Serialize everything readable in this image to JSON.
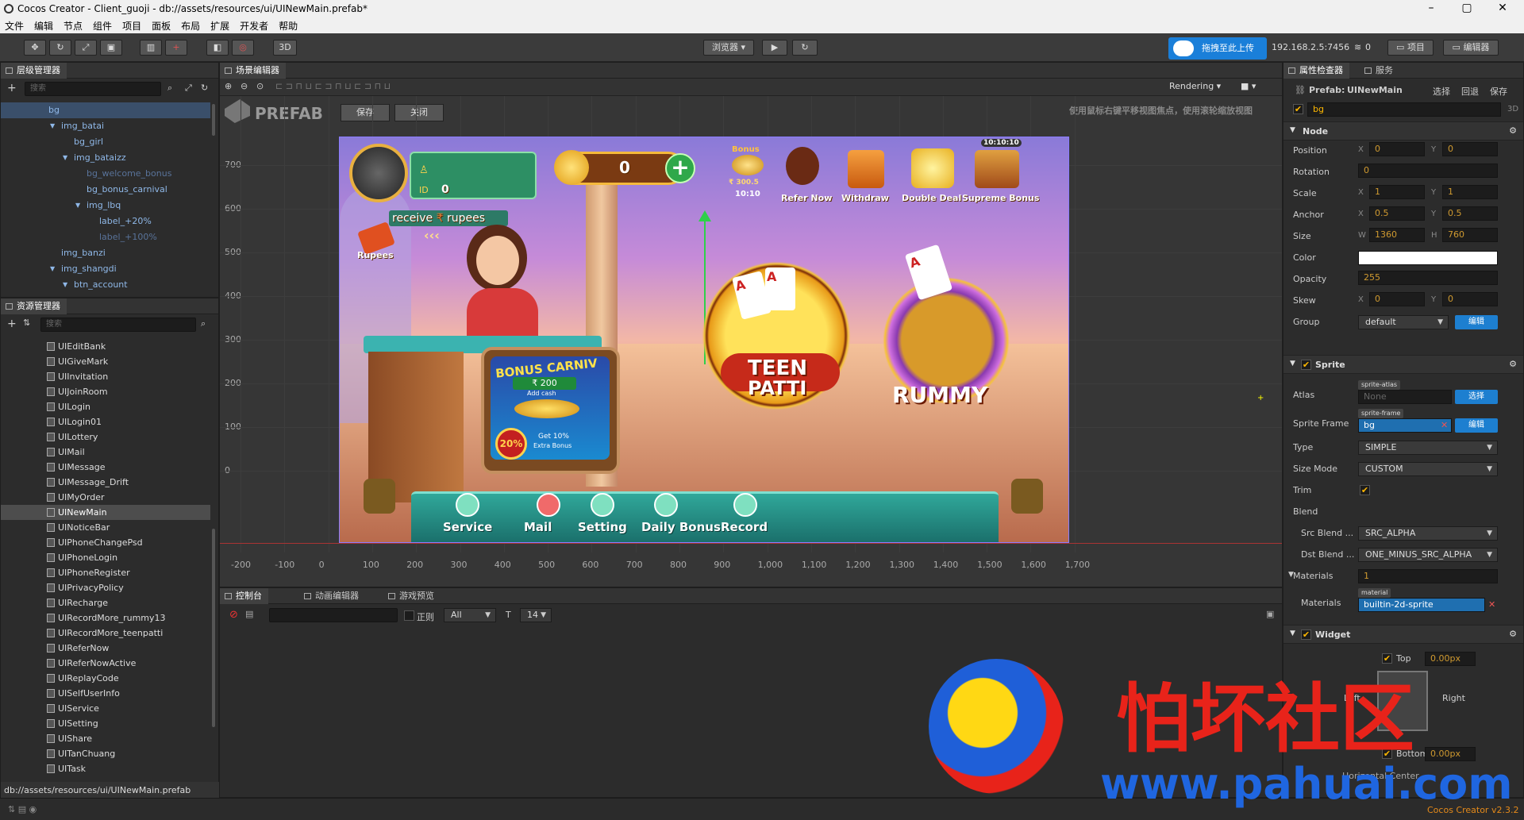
{
  "window": {
    "title": "Cocos Creator - Client_guoji - db://assets/resources/ui/UINewMain.prefab*"
  },
  "menu": [
    "文件",
    "编辑",
    "节点",
    "组件",
    "项目",
    "面板",
    "布局",
    "扩展",
    "开发者",
    "帮助"
  ],
  "toolbar": {
    "btn_3d": "3D",
    "browser": "浏览器 ▾",
    "upload": "拖拽至此上传",
    "ip": "192.168.2.5:7456",
    "count": "0",
    "project": "项目",
    "editor": "编辑器"
  },
  "hierarchy": {
    "tab": "层级管理器",
    "search_placeholder": "搜索",
    "items": [
      {
        "label": "bg",
        "indent": 0
      },
      {
        "label": "img_batai",
        "indent": 1
      },
      {
        "label": "bg_girl",
        "indent": 2
      },
      {
        "label": "img_bataizz",
        "indent": 2
      },
      {
        "label": "bg_welcome_bonus",
        "indent": 3,
        "dim": true
      },
      {
        "label": "bg_bonus_carnival",
        "indent": 3
      },
      {
        "label": "img_lbq",
        "indent": 3
      },
      {
        "label": "label_+20%",
        "indent": 4
      },
      {
        "label": "label_+100%",
        "indent": 4,
        "dim": true
      },
      {
        "label": "img_banzi",
        "indent": 1
      },
      {
        "label": "img_shangdi",
        "indent": 1
      },
      {
        "label": "btn_account",
        "indent": 2
      }
    ]
  },
  "assets": {
    "tab": "资源管理器",
    "search_placeholder": "搜索",
    "items": [
      "UIEditBank",
      "UIGiveMark",
      "UIInvitation",
      "UIJoinRoom",
      "UILogin",
      "UILogin01",
      "UILottery",
      "UIMail",
      "UIMessage",
      "UIMessage_Drift",
      "UIMyOrder",
      "UINewMain",
      "UINoticeBar",
      "UIPhoneChangePsd",
      "UIPhoneLogin",
      "UIPhoneRegister",
      "UIPrivacyPolicy",
      "UIRecharge",
      "UIRecordMore_rummy13",
      "UIRecordMore_teenpatti",
      "UIReferNow",
      "UIReferNowActive",
      "UIReplayCode",
      "UISelfUserInfo",
      "UIService",
      "UISetting",
      "UIShare",
      "UITanChuang",
      "UITask"
    ],
    "selected": "UINewMain",
    "path": "db://assets/resources/ui/UINewMain.prefab"
  },
  "scene": {
    "tab": "场景编辑器",
    "rendering": "Rendering",
    "prefab_label": "PREFAB",
    "save": "保存",
    "close": "关闭",
    "hint": "使用鼠标右键平移视图焦点，使用滚轮缩放视图",
    "y_ticks": [
      "700",
      "600",
      "500",
      "400",
      "300",
      "200",
      "100",
      "0"
    ],
    "x_ticks": [
      "-200",
      "-100",
      "0",
      "100",
      "200",
      "300",
      "400",
      "500",
      "600",
      "700",
      "800",
      "900",
      "1,000",
      "1,100",
      "1,200",
      "1,300",
      "1,400",
      "1,500",
      "1,600",
      "1,700"
    ]
  },
  "game": {
    "coins": "0",
    "id_value": "0",
    "receive": "receive",
    "rupees_word": "rupees",
    "rupees_icon": "Rupees",
    "bonus": "Bonus",
    "bonus_amount": "₹ 300.5",
    "bonus_time": "10:10",
    "top_time": "10:10:10",
    "top_items": [
      "Refer Now",
      "Withdraw",
      "Double Deal",
      "Supreme Bonus"
    ],
    "carnival": "BONUS CARNIV",
    "cash": "₹ 200",
    "add_cash": "Add cash",
    "pct": "20%",
    "get": "Get 10%",
    "extra": "Extra Bonus",
    "game1_a": "TEEN",
    "game1_b": "PATTI",
    "game2": "RUMMY",
    "bottom": [
      "Service",
      "Mail",
      "Setting",
      "Daily Bonus",
      "Record"
    ]
  },
  "console": {
    "tabs": [
      "控制台",
      "动画编辑器",
      "游戏预览"
    ],
    "regex": "正则",
    "filter": "All",
    "fontsize": "14"
  },
  "inspector": {
    "tabs": [
      "属性检查器",
      "服务"
    ],
    "prefab_label": "Prefab:",
    "prefab_name": "UINewMain",
    "select": "选择",
    "revert": "回退",
    "save": "保存",
    "node_name": "bg",
    "badge_3d": "3D",
    "node_section": "Node",
    "position": {
      "label": "Position",
      "x": "0",
      "y": "0"
    },
    "rotation": {
      "label": "Rotation",
      "value": "0"
    },
    "scale": {
      "label": "Scale",
      "x": "1",
      "y": "1"
    },
    "anchor": {
      "label": "Anchor",
      "x": "0.5",
      "y": "0.5"
    },
    "size": {
      "label": "Size",
      "w": "1360",
      "h": "760"
    },
    "color": {
      "label": "Color",
      "value": "#ffffff"
    },
    "opacity": {
      "label": "Opacity",
      "value": "255"
    },
    "skew": {
      "label": "Skew",
      "x": "0",
      "y": "0"
    },
    "group": {
      "label": "Group",
      "value": "default",
      "edit": "编辑"
    },
    "sprite_section": "Sprite",
    "atlas": {
      "label": "Atlas",
      "tag": "sprite-atlas",
      "value": "None",
      "btn": "选择"
    },
    "sprite_frame": {
      "label": "Sprite Frame",
      "tag": "sprite-frame",
      "value": "bg",
      "btn": "编辑"
    },
    "type": {
      "label": "Type",
      "value": "SIMPLE"
    },
    "size_mode": {
      "label": "Size Mode",
      "value": "CUSTOM"
    },
    "trim": {
      "label": "Trim"
    },
    "blend": {
      "label": "Blend"
    },
    "src_blend": {
      "label": "Src Blend ...",
      "value": "SRC_ALPHA"
    },
    "dst_blend": {
      "label": "Dst Blend ...",
      "value": "ONE_MINUS_SRC_ALPHA"
    },
    "materials_count": {
      "label": "Materials",
      "value": "1"
    },
    "materials": {
      "label": "Materials",
      "tag": "material",
      "value": "builtin-2d-sprite"
    },
    "widget_section": "Widget",
    "top": {
      "label": "Top",
      "value": "0.00px"
    },
    "left": "Left",
    "right": "Right",
    "bottom": {
      "label": "Bottom",
      "value": "0.00px"
    },
    "hcenter": "Horizontal Center"
  },
  "status": {
    "version": "Cocos Creator v2.3.2"
  },
  "watermark": {
    "cn": "怕坏社区",
    "url": "www.pahuai.com"
  }
}
